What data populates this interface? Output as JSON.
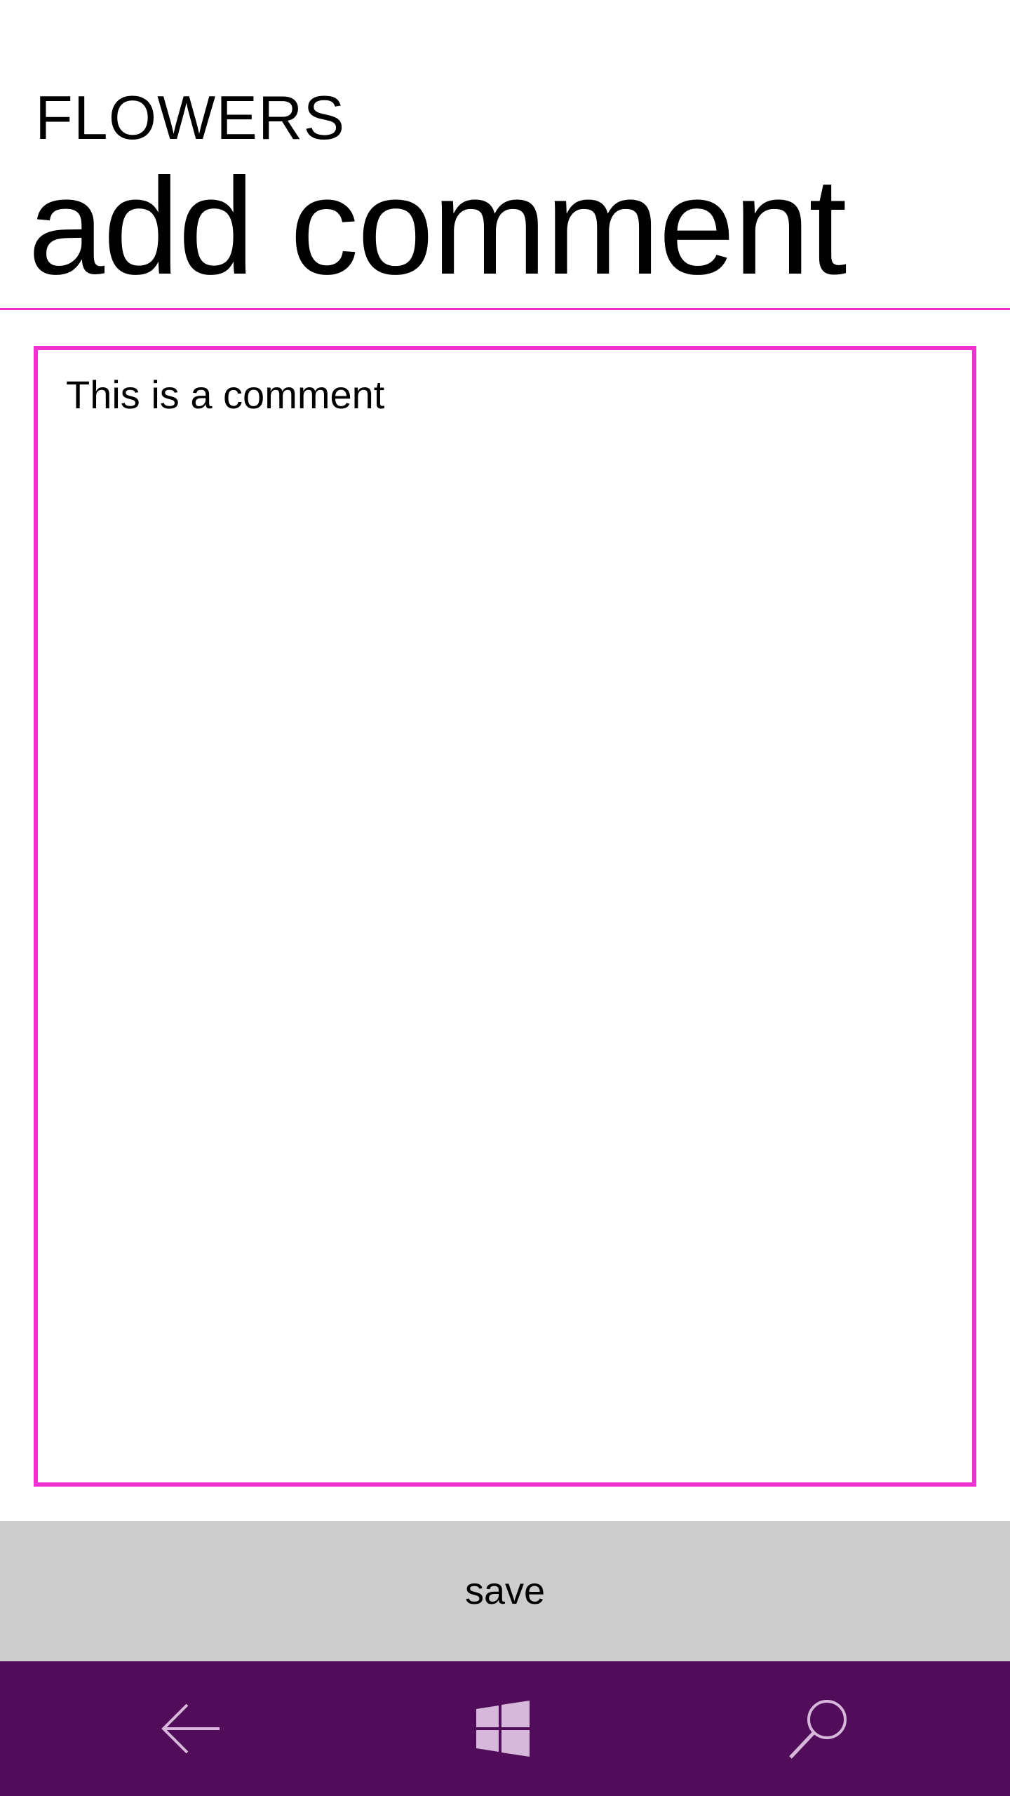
{
  "header": {
    "app_title": "FLOWERS",
    "page_title": "add comment"
  },
  "comment": {
    "value": "This is a comment"
  },
  "actions": {
    "save_label": "save"
  },
  "nav": {
    "back_icon": "back-arrow-icon",
    "home_icon": "windows-logo-icon",
    "search_icon": "search-icon"
  },
  "colors": {
    "accent": "#f030d0",
    "nav_background": "#510c5a",
    "save_background": "#cccccc",
    "nav_icon": "#d6b8db"
  }
}
